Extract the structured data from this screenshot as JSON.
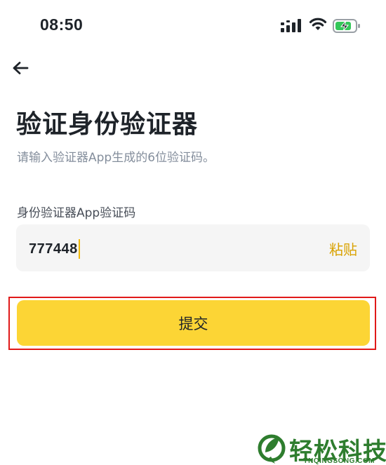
{
  "status_bar": {
    "time": "08:50",
    "icons": [
      "cellular-signal-icon",
      "wifi-icon",
      "battery-charging-icon"
    ]
  },
  "header": {
    "back_icon": "back-arrow-icon"
  },
  "page": {
    "title": "验证身份验证器",
    "subtitle": "请输入验证器App生成的6位验证码。"
  },
  "code_field": {
    "label": "身份验证器App验证码",
    "value": "777448",
    "paste_label": "粘贴"
  },
  "submit": {
    "label": "提交"
  },
  "watermark": {
    "text": "轻松科技",
    "subtext": "YNQINGSONG.COM"
  },
  "colors": {
    "accent": "#fcd535",
    "paste_text": "#d9a200",
    "highlight_border": "#e01919",
    "battery_fill": "#33c759",
    "watermark": "#2e7d2e"
  }
}
